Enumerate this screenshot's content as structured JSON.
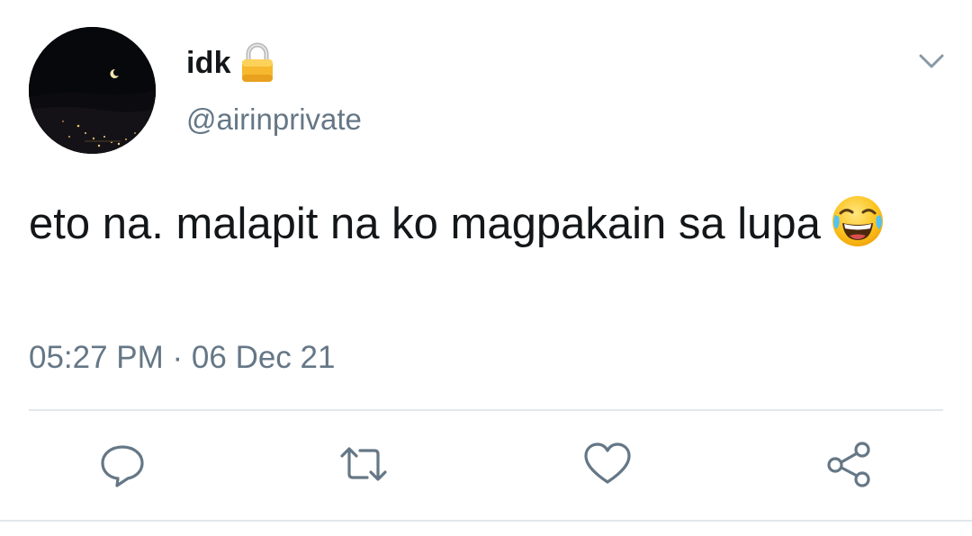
{
  "user": {
    "display_name": "idk",
    "handle": "@airinprivate",
    "protected_icon": "lock-icon",
    "avatar": "night-sky-moon-avatar"
  },
  "tweet": {
    "text": "eto na. malapit na ko magpakain sa lupa",
    "emoji": "face-with-tears-of-joy",
    "timestamp": "05:27 PM · 06 Dec 21"
  },
  "actions": {
    "reply_icon": "reply-icon",
    "retweet_icon": "retweet-icon",
    "like_icon": "heart-icon",
    "share_icon": "share-icon",
    "menu_icon": "chevron-down-icon"
  },
  "colors": {
    "text_primary": "#14171a",
    "text_secondary": "#657786",
    "icon_gray": "#657786",
    "divider": "#e1e8ed"
  }
}
